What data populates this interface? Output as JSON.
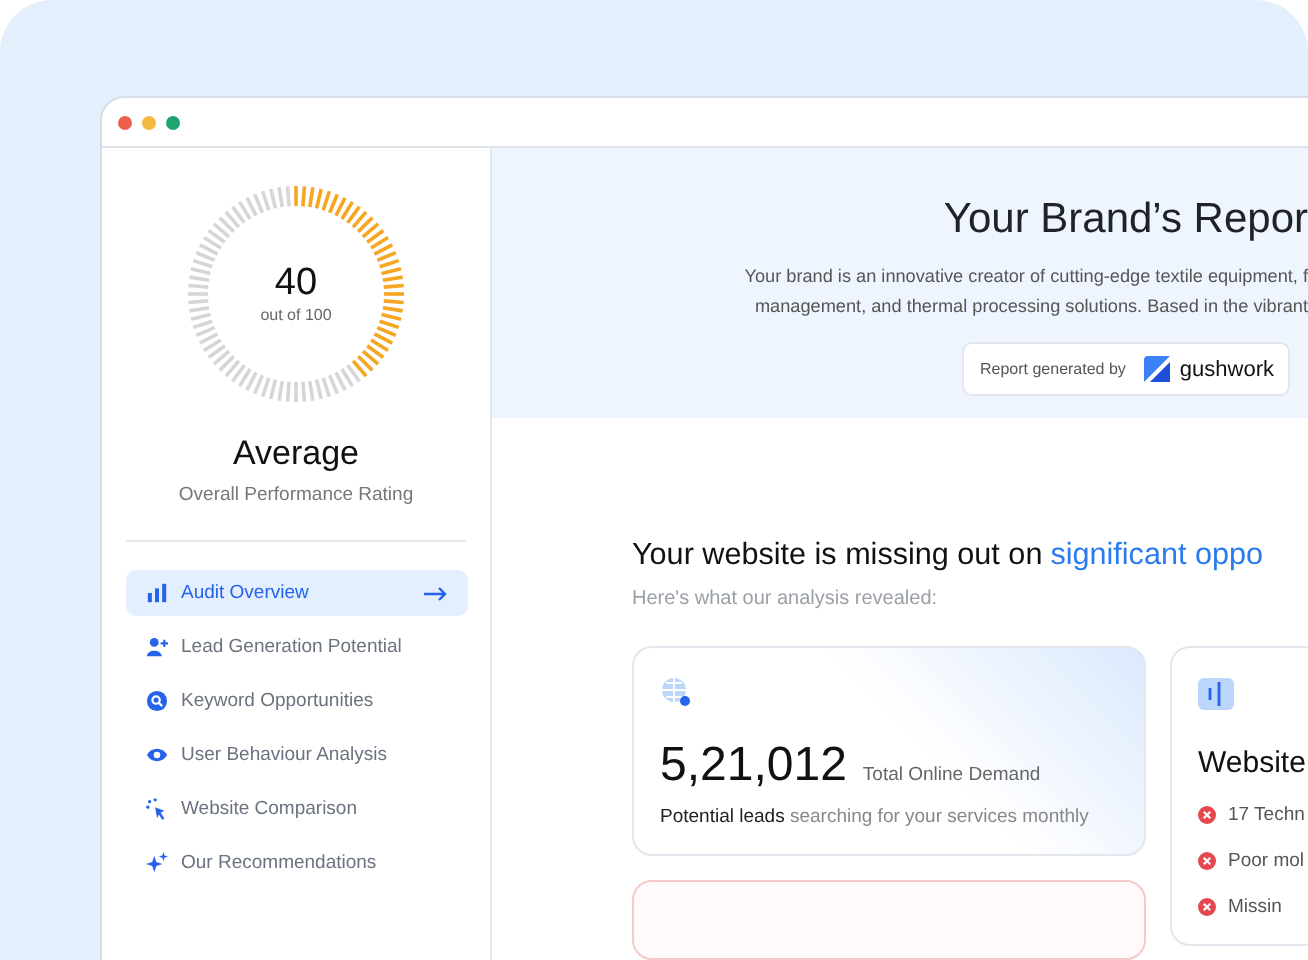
{
  "score": {
    "value": "40",
    "caption": "out of 100",
    "level": 0.4,
    "rating": "Average",
    "subtitle": "Overall Performance Rating"
  },
  "sidebar": {
    "items": [
      {
        "label": "Audit Overview",
        "selected": true
      },
      {
        "label": "Lead Generation Potential",
        "selected": false
      },
      {
        "label": "Keyword Opportunities",
        "selected": false
      },
      {
        "label": "User Behaviour Analysis",
        "selected": false
      },
      {
        "label": "Website Comparison",
        "selected": false
      },
      {
        "label": "Our Recommendations",
        "selected": false
      }
    ]
  },
  "header": {
    "title": "Your Brand’s Repor",
    "description": [
      "Your brand is an innovative creator of cutting-edge textile equipment, f",
      "management, and thermal processing solutions. Based in the vibrant"
    ],
    "badge_label": "Report generated by",
    "badge_brand": "gushwork"
  },
  "section": {
    "heading": "Your website is missing out on",
    "heading_highlight": "significant oppo",
    "subheading": "Here's what our analysis revealed:"
  },
  "demand_card": {
    "value": "5,21,012",
    "label": "Total Online Demand",
    "note": "**Potential leads** searching for your services monthly"
  },
  "website_card": {
    "title": "Website",
    "issues": [
      "17 Techn",
      "Poor mol",
      "Missin"
    ]
  }
}
